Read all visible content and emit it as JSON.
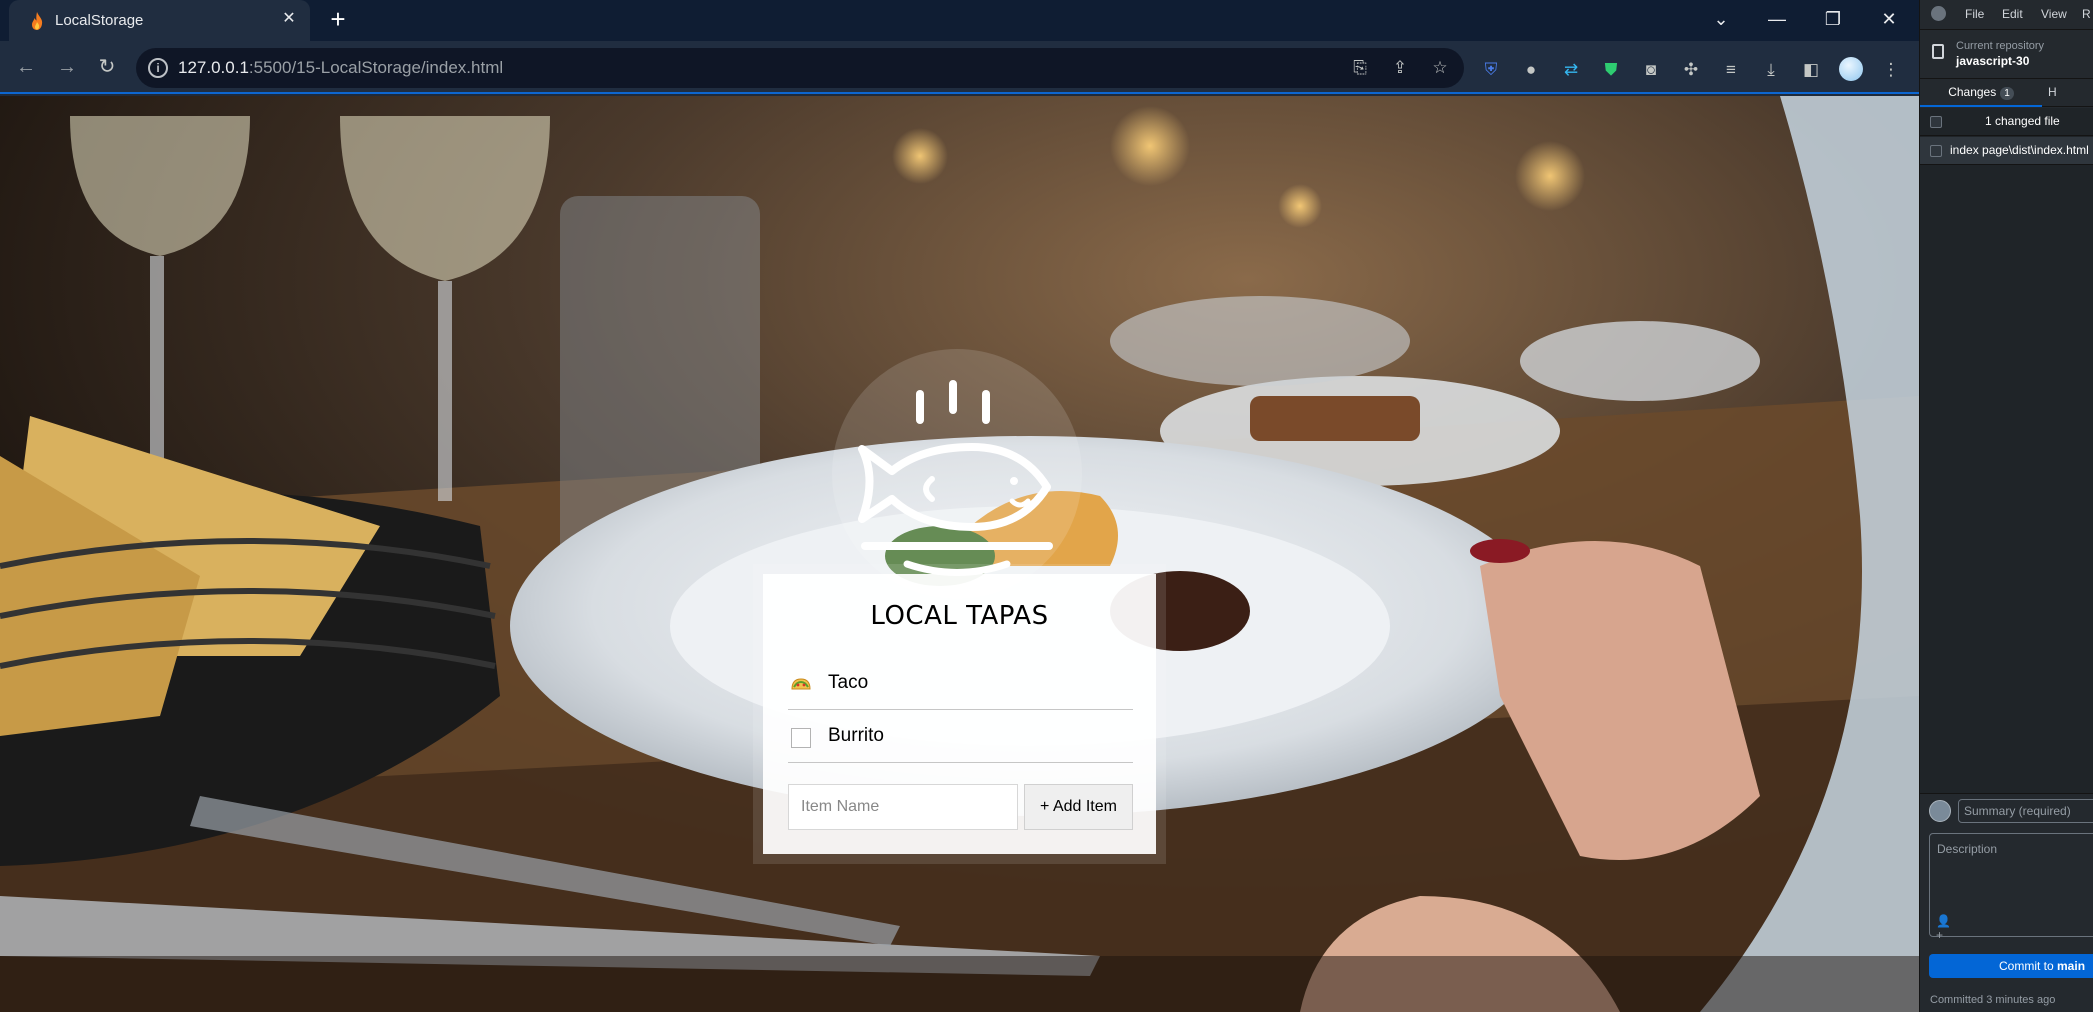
{
  "browser": {
    "tab_title": "LocalStorage",
    "url_host": "127.0.0.1",
    "url_rest": ":5500/15-LocalStorage/index.html"
  },
  "page": {
    "heading": "LOCAL TAPAS",
    "items": [
      {
        "label": "Taco",
        "icon": "taco-emoji",
        "checked": true
      },
      {
        "label": "Burrito",
        "icon": "checkbox",
        "checked": false
      }
    ],
    "input_placeholder": "Item Name",
    "add_button": "+ Add Item"
  },
  "github": {
    "menu": [
      "File",
      "Edit",
      "View",
      "R"
    ],
    "repo_label": "Current repository",
    "repo_name": "javascript-30",
    "tab_changes": "Changes",
    "tab_changes_count": "1",
    "tab_history": "H",
    "changed_files": "1 changed file",
    "file_path": "index page\\dist\\index.html",
    "summary_placeholder": "Summary (required)",
    "description_placeholder": "Description",
    "commit_prefix": "Commit to ",
    "commit_branch": "main",
    "status": "Committed 3 minutes ago"
  },
  "colors": {
    "accent": "#0366d6",
    "toolbar": "#202d40",
    "tabstrip": "#0f1d33"
  }
}
